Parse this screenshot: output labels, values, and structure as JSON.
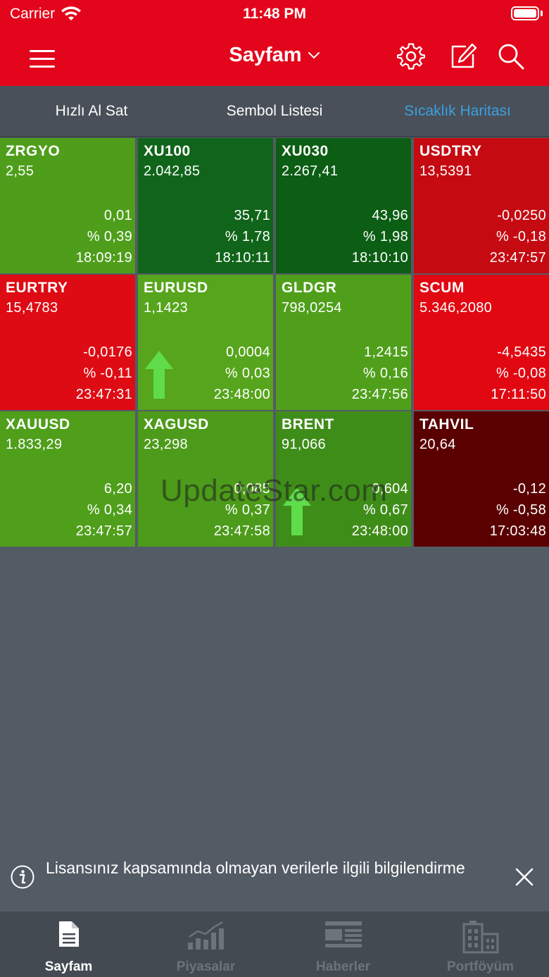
{
  "status_bar": {
    "carrier": "Carrier",
    "time": "11:48 PM"
  },
  "nav": {
    "title": "Sayfam",
    "icons": [
      "menu-icon",
      "gear-icon",
      "edit-icon",
      "search-icon"
    ]
  },
  "tabs": [
    {
      "label": "Hızlı Al Sat",
      "active": false
    },
    {
      "label": "Sembol Listesi",
      "active": false
    },
    {
      "label": "Sıcaklık Haritası",
      "active": true
    }
  ],
  "colors": {
    "header_red": "#e3051b",
    "light_green": "#4e9e1b",
    "dark_green": "#0f6417",
    "red": "#e00813",
    "dark_red": "#c50a12",
    "maroon": "#5a0000",
    "active_tab": "#3aa0e0",
    "up_arrow": "#5fdc4a"
  },
  "heatmap": [
    {
      "symbol": "ZRGYO",
      "price": "2,55",
      "change": "0,01",
      "percent": "% 0,39",
      "time": "18:09:19",
      "color": "#4e9e1b",
      "arrow": false
    },
    {
      "symbol": "XU100",
      "price": "2.042,85",
      "change": "35,71",
      "percent": "% 1,78",
      "time": "18:10:11",
      "color": "#10651a",
      "arrow": false
    },
    {
      "symbol": "XU030",
      "price": "2.267,41",
      "change": "43,96",
      "percent": "% 1,98",
      "time": "18:10:10",
      "color": "#0c5e14",
      "arrow": false
    },
    {
      "symbol": "USDTRY",
      "price": "13,5391",
      "change": "-0,0250",
      "percent": "% -0,18",
      "time": "23:47:57",
      "color": "#c50a12",
      "arrow": false
    },
    {
      "symbol": "EURTRY",
      "price": "15,4783",
      "change": "-0,0176",
      "percent": "% -0,11",
      "time": "23:47:31",
      "color": "#de0b14",
      "arrow": false
    },
    {
      "symbol": "EURUSD",
      "price": "1,1423",
      "change": "0,0004",
      "percent": "% 0,03",
      "time": "23:48:00",
      "color": "#56a51c",
      "arrow": true
    },
    {
      "symbol": "GLDGR",
      "price": "798,0254",
      "change": "1,2415",
      "percent": "% 0,16",
      "time": "23:47:56",
      "color": "#4f9f1b",
      "arrow": false
    },
    {
      "symbol": "SCUM",
      "price": "5.346,2080",
      "change": "-4,5435",
      "percent": "% -0,08",
      "time": "17:11:50",
      "color": "#e10812",
      "arrow": false
    },
    {
      "symbol": "XAUUSD",
      "price": "1.833,29",
      "change": "6,20",
      "percent": "% 0,34",
      "time": "23:47:57",
      "color": "#4f9f1b",
      "arrow": false
    },
    {
      "symbol": "XAGUSD",
      "price": "23,298",
      "change": "0,085",
      "percent": "% 0,37",
      "time": "23:47:58",
      "color": "#4c9b1a",
      "arrow": false
    },
    {
      "symbol": "BRENT",
      "price": "91,066",
      "change": "0,604",
      "percent": "% 0,67",
      "time": "23:48:00",
      "color": "#3f8d19",
      "arrow": true
    },
    {
      "symbol": "TAHVIL",
      "price": "20,64",
      "change": "-0,12",
      "percent": "% -0,58",
      "time": "17:03:48",
      "color": "#5a0000",
      "arrow": false
    }
  ],
  "watermark": "UpdateStar.com",
  "info_banner": {
    "text": "Lisansınız kapsamında olmayan verilerle ilgili bilgilendirme"
  },
  "bottom_tabs": [
    {
      "label": "Sayfam",
      "icon": "document-icon",
      "active": true
    },
    {
      "label": "Piyasalar",
      "icon": "chart-icon",
      "active": false
    },
    {
      "label": "Haberler",
      "icon": "news-icon",
      "active": false
    },
    {
      "label": "Portföyüm",
      "icon": "building-icon",
      "active": false
    }
  ]
}
